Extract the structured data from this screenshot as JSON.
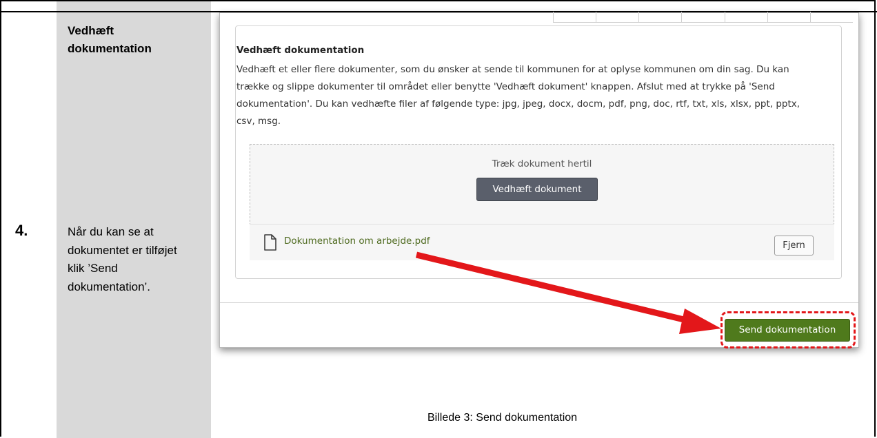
{
  "step": {
    "number": "4.",
    "title": "Vedhæft dokumentation",
    "instruction": "Når du kan se at dokumentet er tilføjet klik ’Send dokumentation’."
  },
  "screenshot": {
    "panel_title": "Vedhæft dokumentation",
    "description": "Vedhæft et eller flere dokumenter, som du ønsker at sende til kommunen for at oplyse kommunen om din sag. Du kan trække og slippe dokumenter til området eller benytte 'Vedhæft dokument' knappen. Afslut med at trykke på 'Send dokumentation'. Du kan vedhæfte filer af følgende type: jpg, jpeg, docx, docm, pdf, png, doc, rtf, txt, xls, xlsx, ppt, pptx, csv, msg.",
    "dropzone_hint": "Træk dokument hertil",
    "attach_button": "Vedhæft dokument",
    "file_name": "Dokumentation om arbejde.pdf",
    "file_icon": "document-icon",
    "remove_button": "Fjern",
    "send_button": "Send dokumentation"
  },
  "caption": "Billede 3: Send dokumentation",
  "colors": {
    "send_button": "#4f7a1c",
    "highlight": "#e3171a",
    "arrow": "#e3171a",
    "file_link": "#4e6a1f",
    "attach_button": "#5a5f6b"
  }
}
